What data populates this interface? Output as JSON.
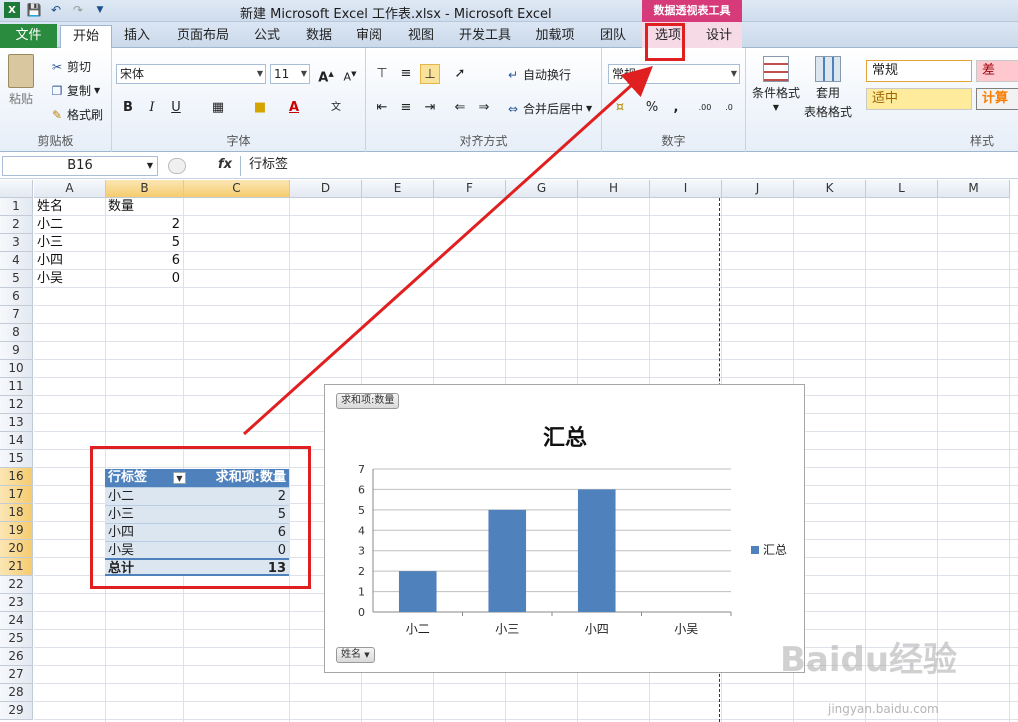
{
  "window": {
    "title": "新建 Microsoft Excel 工作表.xlsx  -  Microsoft Excel",
    "context_tool": "数据透视表工具"
  },
  "tabs": {
    "file": "文件",
    "items": [
      "开始",
      "插入",
      "页面布局",
      "公式",
      "数据",
      "审阅",
      "视图",
      "开发工具",
      "加载项",
      "团队",
      "选项",
      "设计"
    ]
  },
  "ribbon": {
    "clipboard": {
      "label": "剪贴板",
      "paste": "粘贴",
      "cut": "剪切",
      "copy": "复制",
      "format_painter": "格式刷"
    },
    "font": {
      "label": "字体",
      "name": "宋体",
      "size": "11",
      "bold": "B",
      "italic": "I",
      "underline": "U",
      "font_color_letter": "A"
    },
    "alignment": {
      "label": "对齐方式",
      "wrap": "自动换行",
      "merge": "合并后居中"
    },
    "number": {
      "label": "数字",
      "format": "常规",
      "percent": "%",
      "comma": ",",
      "dec_inc": ".00",
      "dec_dec": ".0"
    },
    "styles": {
      "label": "样式",
      "conditional": "条件格式",
      "table_format_1": "套用",
      "table_format_2": "表格格式",
      "normal": "常规",
      "bad": "差",
      "neutral": "适中",
      "calc": "计算"
    }
  },
  "formula_bar": {
    "name_box": "B16",
    "fx": "fx",
    "content": "行标签"
  },
  "columns": [
    "A",
    "B",
    "C",
    "D",
    "E",
    "F",
    "G",
    "H",
    "I",
    "J",
    "K",
    "L",
    "M"
  ],
  "rows": [
    "1",
    "2",
    "3",
    "4",
    "5",
    "6",
    "7",
    "8",
    "9",
    "10",
    "11",
    "12",
    "13",
    "14",
    "15",
    "16",
    "17",
    "18",
    "19",
    "20",
    "21",
    "22",
    "23",
    "24",
    "25",
    "26",
    "27",
    "28",
    "29"
  ],
  "sheet": {
    "header": {
      "a": "姓名",
      "b": "数量"
    },
    "data": [
      {
        "name": "小二",
        "qty": "2"
      },
      {
        "name": "小三",
        "qty": "5"
      },
      {
        "name": "小四",
        "qty": "6"
      },
      {
        "name": "小吴",
        "qty": "0"
      }
    ]
  },
  "pivot": {
    "row_label": "行标签",
    "value_label": "求和项:数量",
    "rows": [
      {
        "name": "小二",
        "qty": "2"
      },
      {
        "name": "小三",
        "qty": "5"
      },
      {
        "name": "小四",
        "qty": "6"
      },
      {
        "name": "小吴",
        "qty": "0"
      }
    ],
    "total_label": "总计",
    "total_value": "13"
  },
  "chart_data": {
    "type": "bar",
    "title": "汇总",
    "value_field_button": "求和项:数量",
    "axis_field_button": "姓名",
    "categories": [
      "小二",
      "小三",
      "小四",
      "小吴"
    ],
    "series": [
      {
        "name": "汇总",
        "values": [
          2,
          5,
          6,
          0
        ],
        "color": "#4f81bd"
      }
    ],
    "ylim": [
      0,
      7
    ],
    "yticks": [
      0,
      1,
      2,
      3,
      4,
      5,
      6,
      7
    ],
    "grid": true,
    "legend": "right"
  },
  "colors": {
    "pivot_header": "#4f81bd",
    "pivot_row": "#dce6f1",
    "annotation": "#e02020",
    "file_tab": "#2a8a3e",
    "context_tab": "#d63a79"
  },
  "watermark": {
    "brand": "Baidu经验",
    "url": "jingyan.baidu.com"
  }
}
